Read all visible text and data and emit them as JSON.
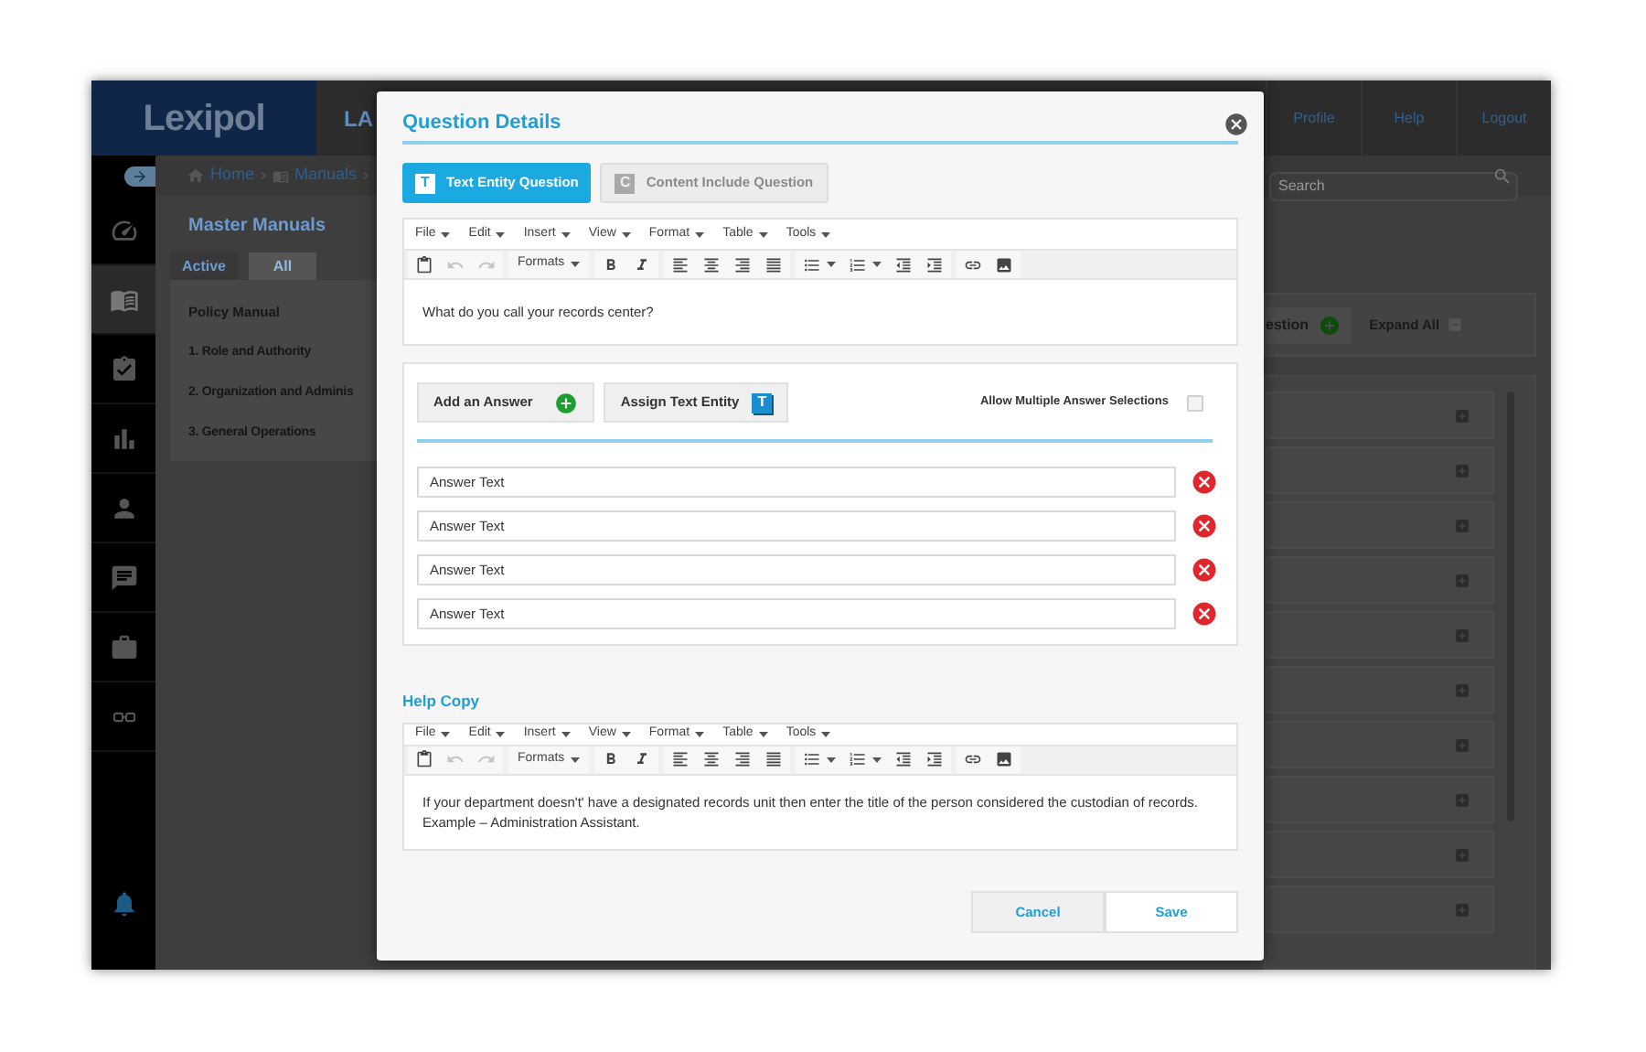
{
  "app": {
    "logo": "Lexipol",
    "title": "LA",
    "nav": [
      "Profile",
      "Help",
      "Logout"
    ],
    "rail": [
      {
        "kind": "gauge",
        "selected": false
      },
      {
        "kind": "book",
        "selected": true
      },
      {
        "kind": "clipboard",
        "selected": false
      },
      {
        "kind": "chart",
        "selected": false
      },
      {
        "kind": "person",
        "selected": false
      },
      {
        "kind": "chat",
        "selected": false
      },
      {
        "kind": "briefcase",
        "selected": false
      },
      {
        "kind": "glasses",
        "selected": false
      }
    ],
    "breadcrumb": [
      {
        "kind": "home",
        "label": "Home"
      },
      {
        "kind": "book",
        "label": "Manuals"
      }
    ],
    "search": {
      "placeholder": "Search"
    },
    "page_title": "Master Manuals",
    "tabs": [
      {
        "label": "Active",
        "selected": false
      },
      {
        "label": "All",
        "selected": true
      }
    ],
    "manual_title": "Policy Manual",
    "chapters": [
      "1. Role and Authority",
      "2. Organization and Adminis",
      "3. General Operations"
    ],
    "add_button": "estion",
    "expand_all": "Expand All"
  },
  "modal": {
    "title": "Question Details",
    "tabs": [
      {
        "label": "Text Entity Question",
        "icon": "T",
        "selected": true
      },
      {
        "label": "Content Include Question",
        "icon": "C",
        "selected": false
      }
    ],
    "question_editor": {
      "menus": [
        "File",
        "Edit",
        "Insert",
        "View",
        "Format",
        "Table",
        "Tools"
      ],
      "tool_groups": [
        [
          {
            "kind": "paste",
            "disabled": false
          },
          {
            "kind": "undo",
            "disabled": true
          },
          {
            "kind": "redo",
            "disabled": true
          }
        ],
        [
          {
            "kind": "formats",
            "label": "Formats",
            "disabled": false
          }
        ],
        [
          {
            "kind": "bold",
            "disabled": false
          },
          {
            "kind": "italic",
            "disabled": false
          }
        ],
        [
          {
            "kind": "align-left",
            "disabled": false
          },
          {
            "kind": "align-center",
            "disabled": false
          },
          {
            "kind": "align-right",
            "disabled": false
          },
          {
            "kind": "align-justify",
            "disabled": false
          }
        ],
        [
          {
            "kind": "bullets",
            "disabled": false
          },
          {
            "kind": "numbers",
            "disabled": false
          },
          {
            "kind": "outdent",
            "disabled": false
          },
          {
            "kind": "indent",
            "disabled": false
          }
        ],
        [
          {
            "kind": "link",
            "disabled": false
          },
          {
            "kind": "image",
            "disabled": false
          }
        ]
      ],
      "content": [
        "What do you call your records center?"
      ]
    },
    "add_answer": "Add an Answer",
    "assign_entity": "Assign Text Entity",
    "entity_icon": "T",
    "allow_multiple": {
      "label": "Allow Multiple Answer Selections",
      "checked": false
    },
    "answers": [
      {
        "value": "Answer Text"
      },
      {
        "value": "Answer Text"
      },
      {
        "value": "Answer Text"
      },
      {
        "value": "Answer Text"
      }
    ],
    "help_heading": "Help Copy",
    "help_editor": {
      "menus": [
        "File",
        "Edit",
        "Insert",
        "View",
        "Format",
        "Table",
        "Tools"
      ],
      "tool_groups": [
        [
          {
            "kind": "paste",
            "disabled": false
          },
          {
            "kind": "undo",
            "disabled": true
          },
          {
            "kind": "redo",
            "disabled": true
          }
        ],
        [
          {
            "kind": "formats",
            "label": "Formats",
            "disabled": false
          }
        ],
        [
          {
            "kind": "bold",
            "disabled": false
          },
          {
            "kind": "italic",
            "disabled": false
          }
        ],
        [
          {
            "kind": "align-left",
            "disabled": false
          },
          {
            "kind": "align-center",
            "disabled": false
          },
          {
            "kind": "align-right",
            "disabled": false
          },
          {
            "kind": "align-justify",
            "disabled": false
          }
        ],
        [
          {
            "kind": "bullets",
            "disabled": false
          },
          {
            "kind": "numbers",
            "disabled": false
          },
          {
            "kind": "outdent",
            "disabled": false
          },
          {
            "kind": "indent",
            "disabled": false
          }
        ],
        [
          {
            "kind": "link",
            "disabled": false
          },
          {
            "kind": "image",
            "disabled": false
          }
        ]
      ],
      "content": [
        "If your department doesn't' have a designated records unit then enter the title of the person considered the custodian of records.",
        "Example – Administration Assistant."
      ]
    },
    "buttons": [
      {
        "kind": "cancel",
        "label": "Cancel"
      },
      {
        "kind": "save",
        "label": "Save"
      }
    ]
  }
}
